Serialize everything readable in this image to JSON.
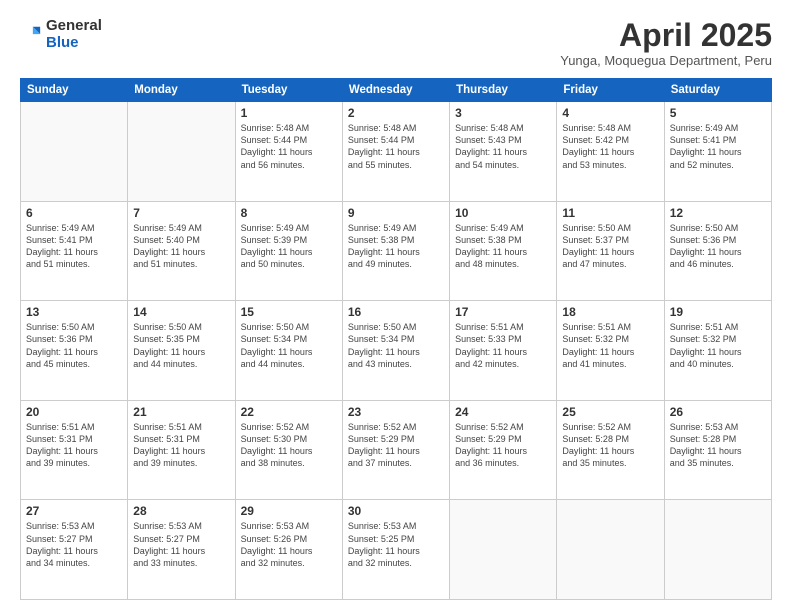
{
  "header": {
    "logo": {
      "general": "General",
      "blue": "Blue"
    },
    "title": "April 2025",
    "subtitle": "Yunga, Moquegua Department, Peru"
  },
  "weekdays": [
    "Sunday",
    "Monday",
    "Tuesday",
    "Wednesday",
    "Thursday",
    "Friday",
    "Saturday"
  ],
  "weeks": [
    [
      {
        "day": "",
        "detail": ""
      },
      {
        "day": "",
        "detail": ""
      },
      {
        "day": "1",
        "detail": "Sunrise: 5:48 AM\nSunset: 5:44 PM\nDaylight: 11 hours\nand 56 minutes."
      },
      {
        "day": "2",
        "detail": "Sunrise: 5:48 AM\nSunset: 5:44 PM\nDaylight: 11 hours\nand 55 minutes."
      },
      {
        "day": "3",
        "detail": "Sunrise: 5:48 AM\nSunset: 5:43 PM\nDaylight: 11 hours\nand 54 minutes."
      },
      {
        "day": "4",
        "detail": "Sunrise: 5:48 AM\nSunset: 5:42 PM\nDaylight: 11 hours\nand 53 minutes."
      },
      {
        "day": "5",
        "detail": "Sunrise: 5:49 AM\nSunset: 5:41 PM\nDaylight: 11 hours\nand 52 minutes."
      }
    ],
    [
      {
        "day": "6",
        "detail": "Sunrise: 5:49 AM\nSunset: 5:41 PM\nDaylight: 11 hours\nand 51 minutes."
      },
      {
        "day": "7",
        "detail": "Sunrise: 5:49 AM\nSunset: 5:40 PM\nDaylight: 11 hours\nand 51 minutes."
      },
      {
        "day": "8",
        "detail": "Sunrise: 5:49 AM\nSunset: 5:39 PM\nDaylight: 11 hours\nand 50 minutes."
      },
      {
        "day": "9",
        "detail": "Sunrise: 5:49 AM\nSunset: 5:38 PM\nDaylight: 11 hours\nand 49 minutes."
      },
      {
        "day": "10",
        "detail": "Sunrise: 5:49 AM\nSunset: 5:38 PM\nDaylight: 11 hours\nand 48 minutes."
      },
      {
        "day": "11",
        "detail": "Sunrise: 5:50 AM\nSunset: 5:37 PM\nDaylight: 11 hours\nand 47 minutes."
      },
      {
        "day": "12",
        "detail": "Sunrise: 5:50 AM\nSunset: 5:36 PM\nDaylight: 11 hours\nand 46 minutes."
      }
    ],
    [
      {
        "day": "13",
        "detail": "Sunrise: 5:50 AM\nSunset: 5:36 PM\nDaylight: 11 hours\nand 45 minutes."
      },
      {
        "day": "14",
        "detail": "Sunrise: 5:50 AM\nSunset: 5:35 PM\nDaylight: 11 hours\nand 44 minutes."
      },
      {
        "day": "15",
        "detail": "Sunrise: 5:50 AM\nSunset: 5:34 PM\nDaylight: 11 hours\nand 44 minutes."
      },
      {
        "day": "16",
        "detail": "Sunrise: 5:50 AM\nSunset: 5:34 PM\nDaylight: 11 hours\nand 43 minutes."
      },
      {
        "day": "17",
        "detail": "Sunrise: 5:51 AM\nSunset: 5:33 PM\nDaylight: 11 hours\nand 42 minutes."
      },
      {
        "day": "18",
        "detail": "Sunrise: 5:51 AM\nSunset: 5:32 PM\nDaylight: 11 hours\nand 41 minutes."
      },
      {
        "day": "19",
        "detail": "Sunrise: 5:51 AM\nSunset: 5:32 PM\nDaylight: 11 hours\nand 40 minutes."
      }
    ],
    [
      {
        "day": "20",
        "detail": "Sunrise: 5:51 AM\nSunset: 5:31 PM\nDaylight: 11 hours\nand 39 minutes."
      },
      {
        "day": "21",
        "detail": "Sunrise: 5:51 AM\nSunset: 5:31 PM\nDaylight: 11 hours\nand 39 minutes."
      },
      {
        "day": "22",
        "detail": "Sunrise: 5:52 AM\nSunset: 5:30 PM\nDaylight: 11 hours\nand 38 minutes."
      },
      {
        "day": "23",
        "detail": "Sunrise: 5:52 AM\nSunset: 5:29 PM\nDaylight: 11 hours\nand 37 minutes."
      },
      {
        "day": "24",
        "detail": "Sunrise: 5:52 AM\nSunset: 5:29 PM\nDaylight: 11 hours\nand 36 minutes."
      },
      {
        "day": "25",
        "detail": "Sunrise: 5:52 AM\nSunset: 5:28 PM\nDaylight: 11 hours\nand 35 minutes."
      },
      {
        "day": "26",
        "detail": "Sunrise: 5:53 AM\nSunset: 5:28 PM\nDaylight: 11 hours\nand 35 minutes."
      }
    ],
    [
      {
        "day": "27",
        "detail": "Sunrise: 5:53 AM\nSunset: 5:27 PM\nDaylight: 11 hours\nand 34 minutes."
      },
      {
        "day": "28",
        "detail": "Sunrise: 5:53 AM\nSunset: 5:27 PM\nDaylight: 11 hours\nand 33 minutes."
      },
      {
        "day": "29",
        "detail": "Sunrise: 5:53 AM\nSunset: 5:26 PM\nDaylight: 11 hours\nand 32 minutes."
      },
      {
        "day": "30",
        "detail": "Sunrise: 5:53 AM\nSunset: 5:25 PM\nDaylight: 11 hours\nand 32 minutes."
      },
      {
        "day": "",
        "detail": ""
      },
      {
        "day": "",
        "detail": ""
      },
      {
        "day": "",
        "detail": ""
      }
    ]
  ]
}
